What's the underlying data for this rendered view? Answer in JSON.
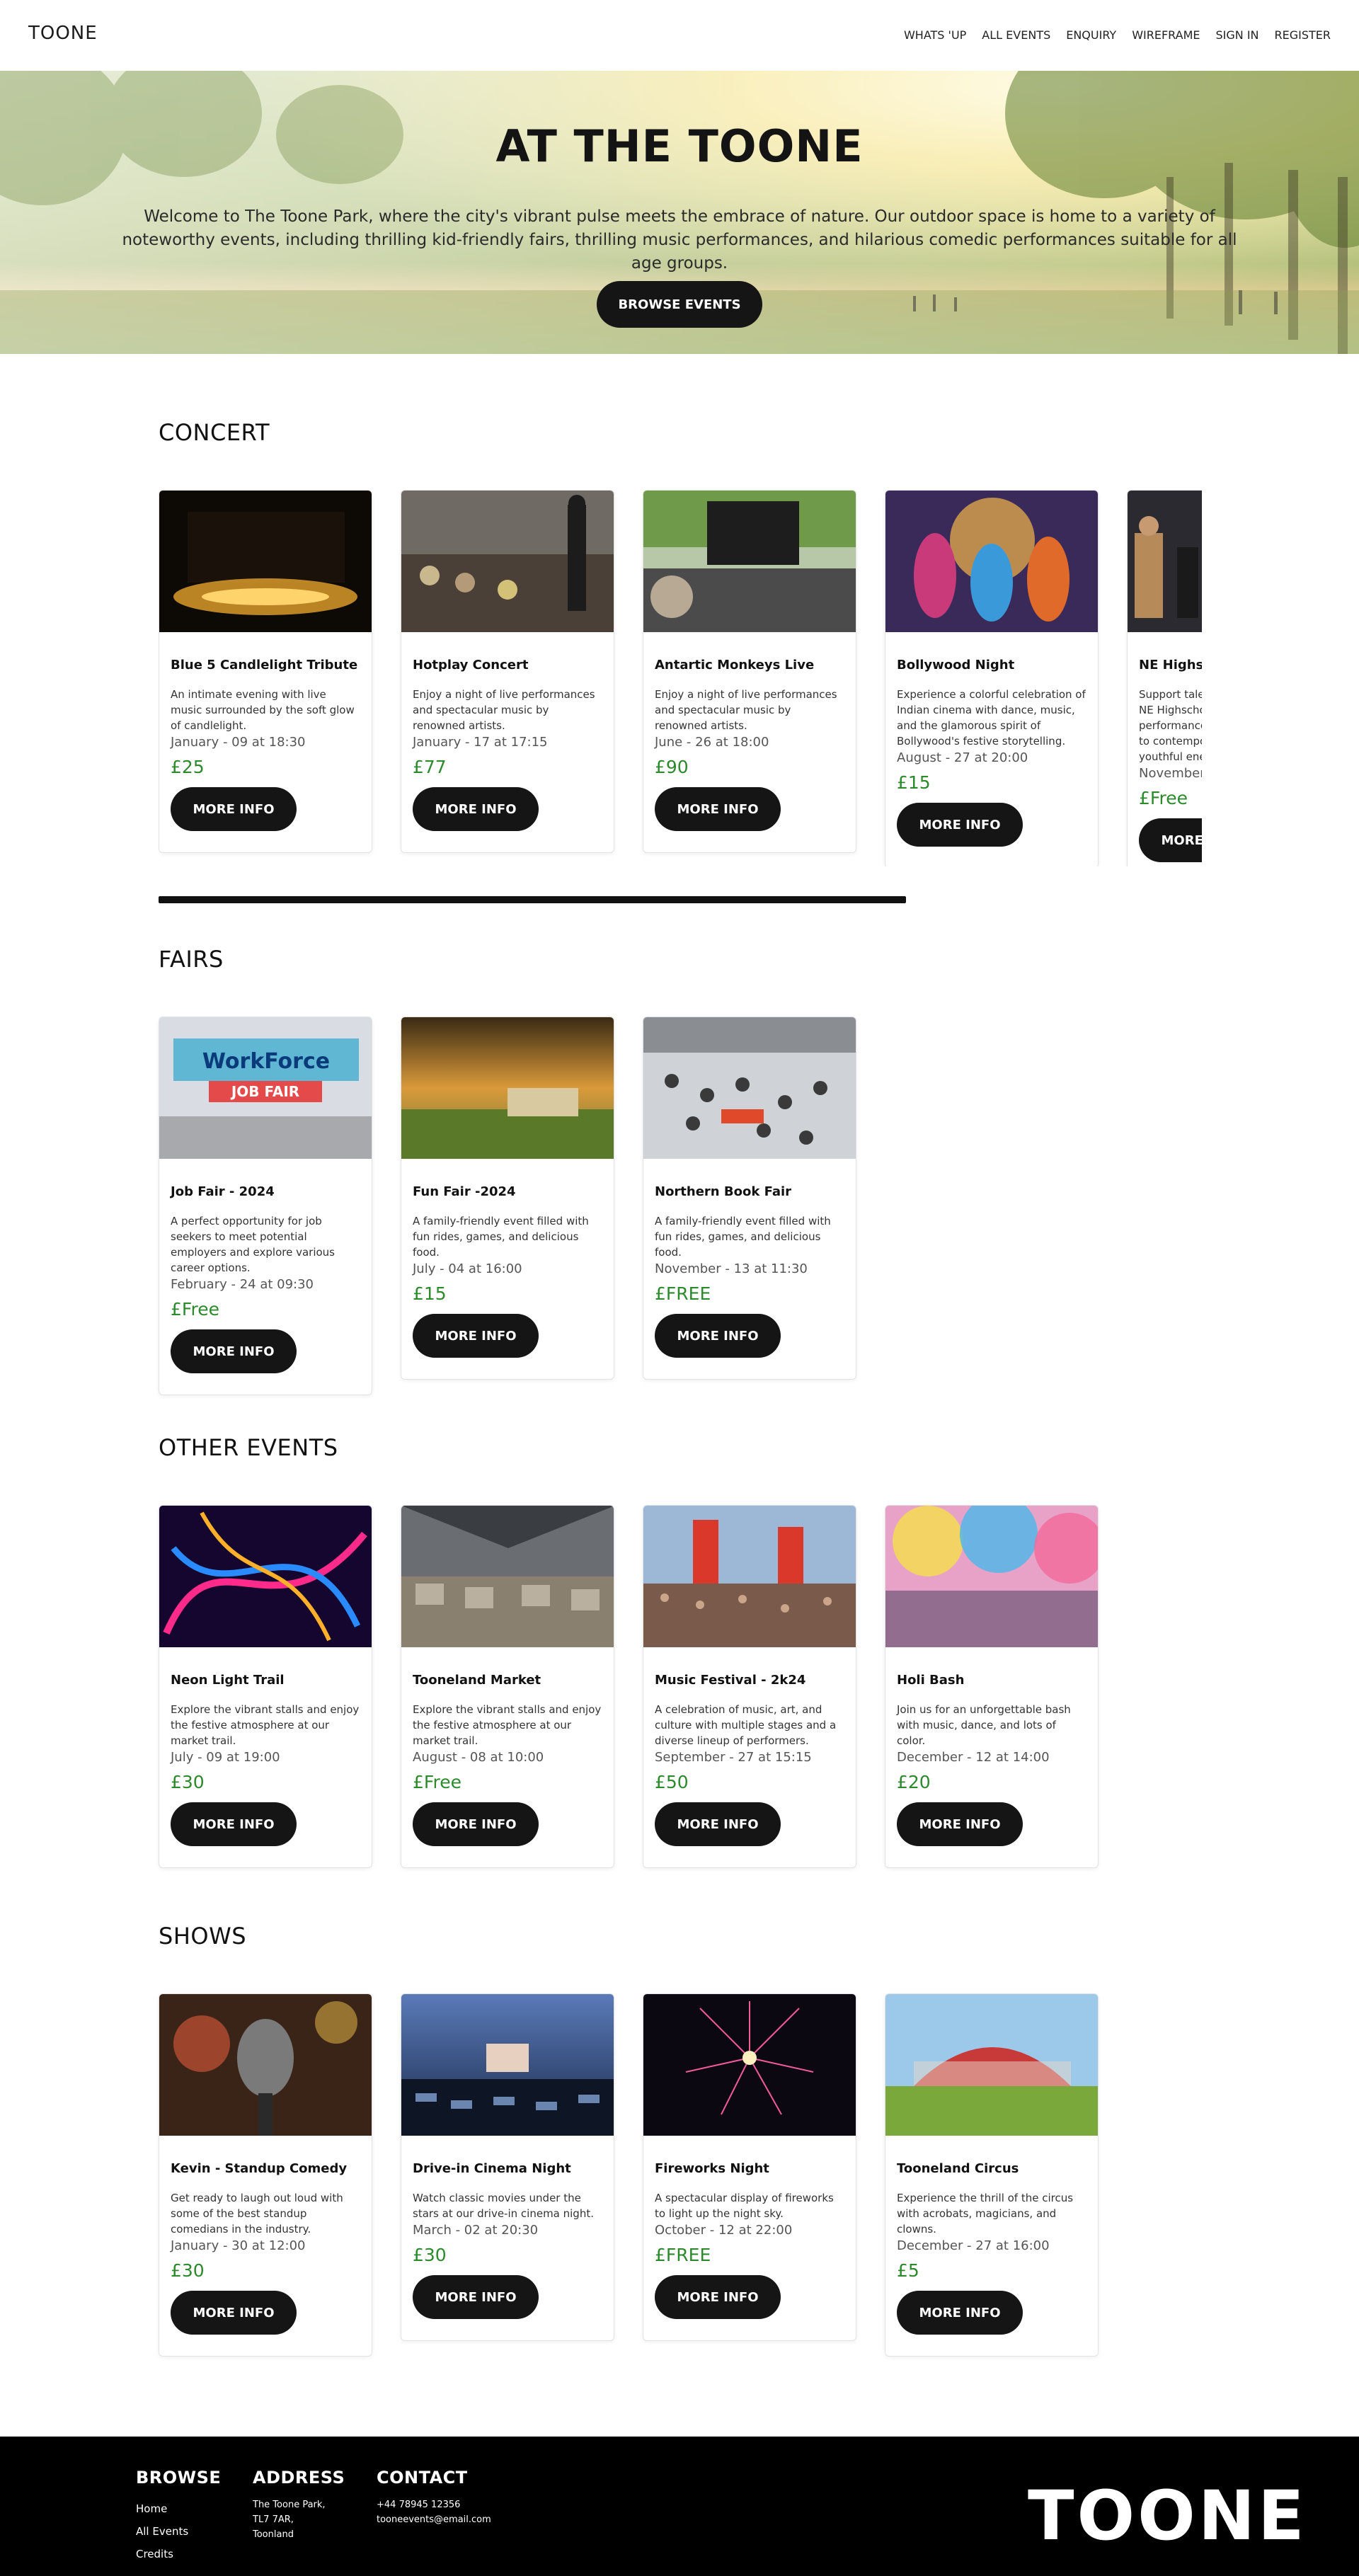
{
  "nav": {
    "logo": "TOONE",
    "items": [
      "WHATS 'UP",
      "ALL EVENTS",
      "ENQUIRY",
      "WIREFRAME",
      "SIGN IN",
      "REGISTER"
    ]
  },
  "hero": {
    "title": "AT THE TOONE",
    "text": "Welcome to The Toone Park, where the city's vibrant pulse meets the embrace of nature. Our outdoor space is home to a variety of noteworthy events, including thrilling kid-friendly fairs, thrilling music performances, and hilarious comedic performances suitable for all age groups.",
    "button": "BROWSE EVENTS"
  },
  "more_label": "MORE INFO",
  "sections": [
    {
      "title": "CONCERT",
      "cards": [
        {
          "title": "Blue 5 Candlelight Tribute",
          "desc": "An intimate evening with live music surrounded by the soft glow of candlelight.",
          "date": "January - 09 at 18:30",
          "price": "£25"
        },
        {
          "title": "Hotplay Concert",
          "desc": "Enjoy a night of live performances and spectacular music by renowned artists.",
          "date": "January - 17 at 17:15",
          "price": "£77"
        },
        {
          "title": "Antartic Monkeys Live",
          "desc": "Enjoy a night of live performances and spectacular music by renowned artists.",
          "date": "June - 26 at 18:00",
          "price": "£90"
        },
        {
          "title": "Bollywood Night",
          "desc": "Experience a colorful celebration of Indian cinema with dance, music, and the glamorous spirit of Bollywood's festive storytelling.",
          "date": "August - 27 at 20:00",
          "price": "£15"
        },
        {
          "title": "NE Highschool Orchestra",
          "desc": "Support talented musicians of the NE Highschool Orchestra in a performance ranging from classical to contemporary, showcasing youthful energy.",
          "date": "November",
          "price": "£Free"
        }
      ]
    },
    {
      "title": "FAIRS",
      "cards": [
        {
          "title": "Job Fair - 2024",
          "desc": "A perfect opportunity for job seekers to meet potential employers and explore various career options.",
          "date": "February - 24 at 09:30",
          "price": "£Free"
        },
        {
          "title": "Fun Fair -2024",
          "desc": "A family-friendly event filled with fun rides, games, and delicious food.",
          "date": "July - 04 at 16:00",
          "price": "£15"
        },
        {
          "title": "Northern Book Fair",
          "desc": "A family-friendly event filled with fun rides, games, and delicious food.",
          "date": "November - 13 at 11:30",
          "price": "£FREE"
        }
      ]
    },
    {
      "title": "OTHER EVENTS",
      "cards": [
        {
          "title": "Neon Light Trail",
          "desc": "Explore the vibrant stalls and enjoy the festive atmosphere at our market trail.",
          "date": "July - 09 at 19:00",
          "price": "£30"
        },
        {
          "title": "Tooneland Market",
          "desc": "Explore the vibrant stalls and enjoy the festive atmosphere at our market trail.",
          "date": "August - 08 at 10:00",
          "price": "£Free"
        },
        {
          "title": "Music Festival - 2k24",
          "desc": "A celebration of music, art, and culture with multiple stages and a diverse lineup of performers.",
          "date": "September - 27 at 15:15",
          "price": "£50"
        },
        {
          "title": "Holi Bash",
          "desc": "Join us for an unforgettable bash with music, dance, and lots of color.",
          "date": "December - 12 at 14:00",
          "price": "£20"
        }
      ]
    },
    {
      "title": "SHOWS",
      "cards": [
        {
          "title": "Kevin - Standup Comedy",
          "desc": "Get ready to laugh out loud with some of the best standup comedians in the industry.",
          "date": "January - 30 at 12:00",
          "price": "£30"
        },
        {
          "title": "Drive-in Cinema Night",
          "desc": "Watch classic movies under the stars at our drive-in cinema night.",
          "date": "March - 02 at 20:30",
          "price": "£30"
        },
        {
          "title": "Fireworks Night",
          "desc": "A spectacular display of fireworks to light up the night sky.",
          "date": "October - 12 at 22:00",
          "price": "£FREE"
        },
        {
          "title": "Tooneland Circus",
          "desc": "Experience the thrill of the circus with acrobats, magicians, and clowns.",
          "date": "December - 27 at 16:00",
          "price": "£5"
        }
      ]
    }
  ],
  "footer": {
    "browse_title": "BROWSE",
    "browse_links": [
      "Home",
      "All Events",
      "Credits"
    ],
    "address_title": "ADDRESS",
    "address_lines": [
      "The Toone Park,",
      "TL7 7AR,",
      "Toonland"
    ],
    "contact_title": "CONTACT",
    "contact_lines": [
      "+44 78945 12356",
      "tooneevents@email.com"
    ],
    "brand": "TOONE"
  },
  "colors": {
    "price_green": "#2c8a2c",
    "button_dark": "#151515",
    "footer_bg": "#000000"
  }
}
